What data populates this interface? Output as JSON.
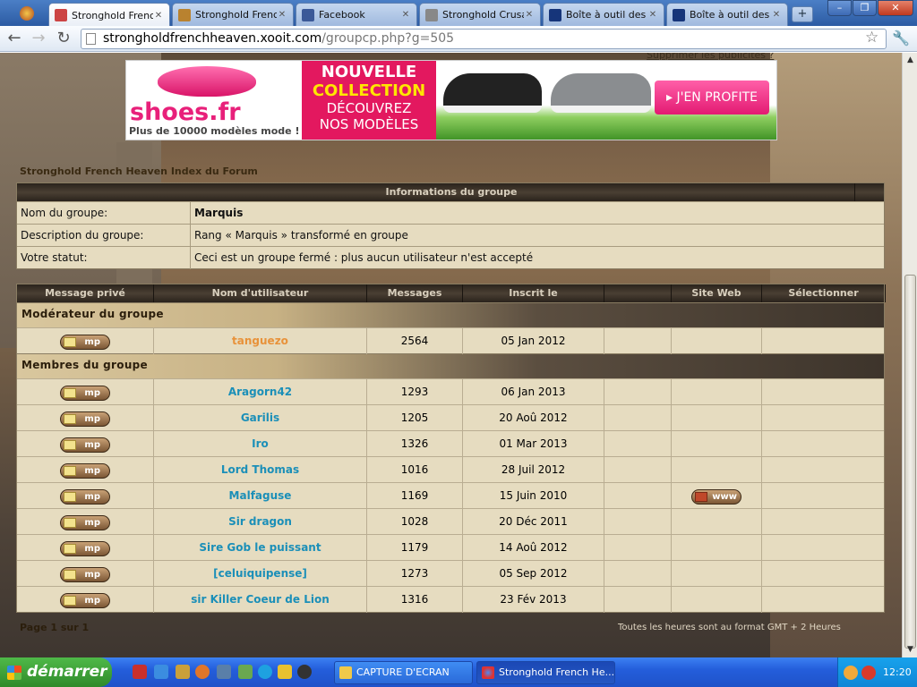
{
  "browser": {
    "tabs": [
      {
        "label": "Stronghold French",
        "active": true,
        "icon_color": "#c44"
      },
      {
        "label": "Stronghold French",
        "active": false,
        "icon_color": "#b9822f"
      },
      {
        "label": "Facebook",
        "active": false,
        "icon_color": "#3b5998"
      },
      {
        "label": "Stronghold Crusad",
        "active": false,
        "icon_color": "#888"
      },
      {
        "label": "Boîte à outil des W",
        "active": false,
        "icon_color": "#16357a"
      },
      {
        "label": "Boîte à outil des W",
        "active": false,
        "icon_color": "#16357a"
      }
    ],
    "new_tab_label": "+",
    "window_controls": {
      "minimize": "–",
      "maximize": "❐",
      "close": "✕"
    },
    "url_host": "strongholdfrenchheaven.xooit.com",
    "url_path": "/groupcp.php?g=505"
  },
  "page": {
    "ad_hint": "Supprimer les publicités ?",
    "ad": {
      "brand": "shoes.fr",
      "tagline": "Plus de 10000 modèles mode !",
      "promo_line1": "NOUVELLE",
      "promo_line2": "COLLECTION",
      "promo_line3": "DÉCOUVREZ",
      "promo_line4": "NOS MODÈLES",
      "cta": "▸ J'EN PROFITE"
    },
    "breadcrumb": "Stronghold French Heaven Index du Forum",
    "group_info": {
      "header": "Informations du groupe",
      "rows": [
        {
          "key": "Nom du groupe:",
          "value": "Marquis",
          "bold": true
        },
        {
          "key": "Description du groupe:",
          "value": "Rang « Marquis » transformé en groupe",
          "bold": false
        },
        {
          "key": "Votre statut:",
          "value": "Ceci est un groupe fermé : plus aucun utilisateur n'est accepté",
          "bold": false
        }
      ]
    },
    "members_table": {
      "headers": [
        "Message privé",
        "Nom d'utilisateur",
        "Messages",
        "Inscrit le",
        "",
        "Site Web",
        "Sélectionner"
      ],
      "moderator_section": "Modérateur du groupe",
      "members_section": "Membres du groupe",
      "pm_label": "mp",
      "www_label": "www",
      "moderators": [
        {
          "name": "tanguezo",
          "posts": "2564",
          "joined": "05 Jan 2012",
          "www": false
        }
      ],
      "members": [
        {
          "name": "Aragorn42",
          "posts": "1293",
          "joined": "06 Jan 2013",
          "www": false
        },
        {
          "name": "Garilis",
          "posts": "1205",
          "joined": "20 Aoû 2012",
          "www": false
        },
        {
          "name": "Iro",
          "posts": "1326",
          "joined": "01 Mar 2013",
          "www": false
        },
        {
          "name": "Lord Thomas",
          "posts": "1016",
          "joined": "28 Juil 2012",
          "www": false
        },
        {
          "name": "Malfaguse",
          "posts": "1169",
          "joined": "15 Juin 2010",
          "www": true
        },
        {
          "name": "Sir dragon",
          "posts": "1028",
          "joined": "20 Déc 2011",
          "www": false
        },
        {
          "name": "Sire Gob le puissant",
          "posts": "1179",
          "joined": "14 Aoû 2012",
          "www": false
        },
        {
          "name": "[celuiquipense]",
          "posts": "1273",
          "joined": "05 Sep 2012",
          "www": false
        },
        {
          "name": "sir Killer Coeur de Lion",
          "posts": "1316",
          "joined": "23 Fév 2013",
          "www": false
        }
      ]
    },
    "pagination": "Page 1 sur 1",
    "timezone": "Toutes les heures sont au format GMT + 2 Heures"
  },
  "taskbar": {
    "start_label": "démarrer",
    "tasks": [
      {
        "label": "CAPTURE D'ECRAN",
        "active": false
      },
      {
        "label": "Stronghold French He...",
        "active": true
      }
    ],
    "clock": "12:20"
  }
}
